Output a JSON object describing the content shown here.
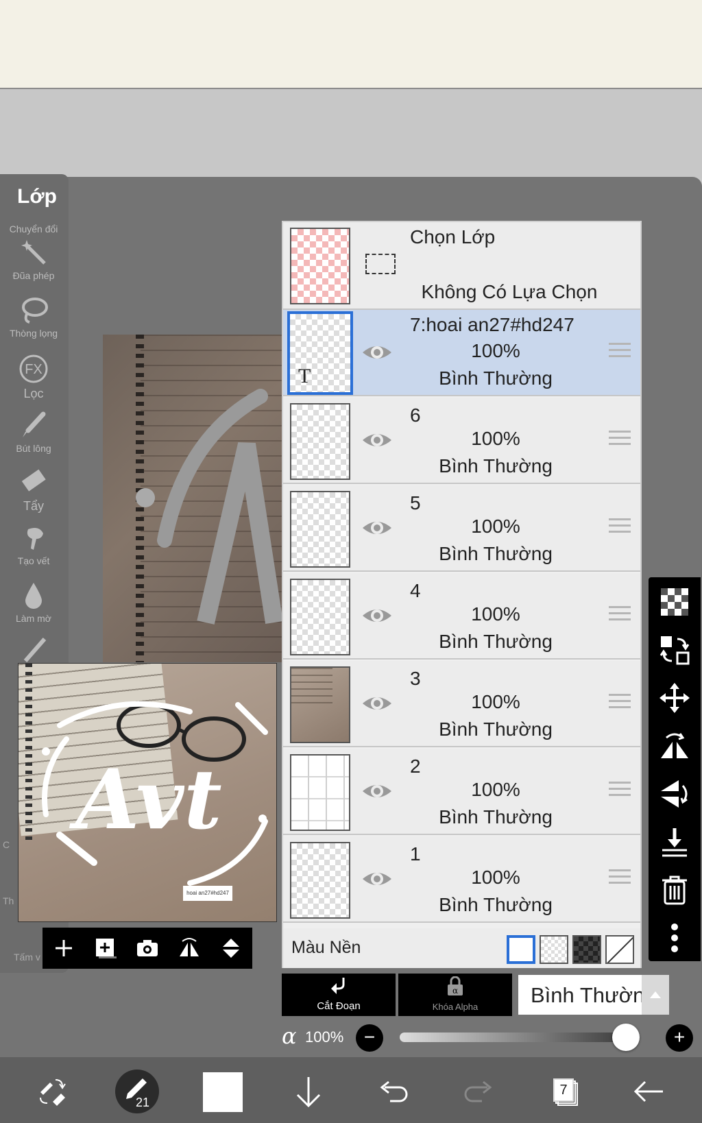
{
  "sidebar": {
    "title": "Lớp",
    "tools": [
      {
        "label": "Chuyển đổi",
        "icon": "transform-icon"
      },
      {
        "label": "Đũa phép",
        "icon": "magic-wand-icon"
      },
      {
        "label": "Thòng lọng",
        "icon": "lasso-icon"
      },
      {
        "label": "Lọc",
        "icon": "fx-filter-icon"
      },
      {
        "label": "Bút lông",
        "icon": "brush-icon"
      },
      {
        "label": "Tẩy",
        "icon": "eraser-icon"
      },
      {
        "label": "Tạo vết",
        "icon": "smudge-icon"
      },
      {
        "label": "Làm mờ",
        "icon": "blur-drop-icon"
      }
    ],
    "partial_labels": [
      "C",
      "Th",
      "Tấm v"
    ]
  },
  "preview": {
    "caption": "hoai an27#hd247",
    "art_text": "Avt"
  },
  "layer_panel": {
    "selection_row": {
      "title": "Chọn Lớp",
      "status": "Không Có Lựa Chọn"
    },
    "layers": [
      {
        "number": "7:hoai an27#hd247",
        "opacity": "100%",
        "mode": "Bình Thường",
        "selected": true,
        "thumb": "text"
      },
      {
        "number": "6",
        "opacity": "100%",
        "mode": "Bình Thường",
        "selected": false,
        "thumb": "transparent"
      },
      {
        "number": "5",
        "opacity": "100%",
        "mode": "Bình Thường",
        "selected": false,
        "thumb": "transparent"
      },
      {
        "number": "4",
        "opacity": "100%",
        "mode": "Bình Thường",
        "selected": false,
        "thumb": "transparent"
      },
      {
        "number": "3",
        "opacity": "100%",
        "mode": "Bình Thường",
        "selected": false,
        "thumb": "photo"
      },
      {
        "number": "2",
        "opacity": "100%",
        "mode": "Bình Thường",
        "selected": false,
        "thumb": "grid"
      },
      {
        "number": "1",
        "opacity": "100%",
        "mode": "Bình Thường",
        "selected": false,
        "thumb": "transparent"
      }
    ],
    "background_label": "Màu Nền"
  },
  "controls": {
    "clip_label": "Cắt Đoạn",
    "alpha_lock_label": "Khóa Alpha",
    "blend_mode": "Bình Thường",
    "alpha_symbol": "α",
    "opacity_value": "100%",
    "opacity_fraction": 1.0,
    "minus": "−",
    "plus": "+"
  },
  "bottom_bar": {
    "brush_size": "21",
    "layer_count": "7",
    "color": "#ffffff"
  },
  "colors": {
    "accent": "#2a6fd6",
    "selected_row": "#c9d7ec"
  }
}
